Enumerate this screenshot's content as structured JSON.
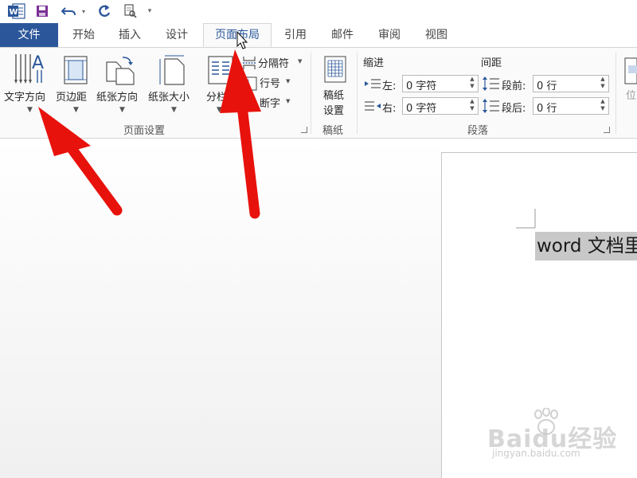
{
  "colors": {
    "word_blue": "#2b579a",
    "ribbon_bg": "#fafafa",
    "arrow_red": "#e8120c"
  },
  "quick_access": {
    "items": [
      "word-logo-icon",
      "save-icon",
      "undo-icon",
      "redo-icon",
      "print-preview-icon",
      "customize-dropdown-icon"
    ]
  },
  "tabs": [
    "文件",
    "开始",
    "插入",
    "设计",
    "页面布局",
    "引用",
    "邮件",
    "审阅",
    "视图"
  ],
  "active_tab": "页面布局",
  "ribbon": {
    "page_setup": {
      "text_direction": "文字方向",
      "margins": "页边距",
      "orientation": "纸张方向",
      "size": "纸张大小",
      "columns": "分栏",
      "breaks": "分隔符",
      "line_numbers": "行号",
      "hyphenation": "断字",
      "group_label": "页面设置"
    },
    "manuscript": {
      "button_line1": "稿纸",
      "button_line2": "设置",
      "group_label": "稿纸"
    },
    "paragraph": {
      "indent_header": "缩进",
      "spacing_header": "间距",
      "left_label": "左:",
      "right_label": "右:",
      "before_label": "段前:",
      "after_label": "段后:",
      "left_value": "0 字符",
      "right_value": "0 字符",
      "before_value": "0 行",
      "after_value": "0 行",
      "group_label": "段落"
    },
    "arrange": {
      "position": "位"
    }
  },
  "document": {
    "text": "word 文档里"
  },
  "watermark": {
    "brand": "Baidu经验",
    "url": "jingyan.baidu.com"
  }
}
